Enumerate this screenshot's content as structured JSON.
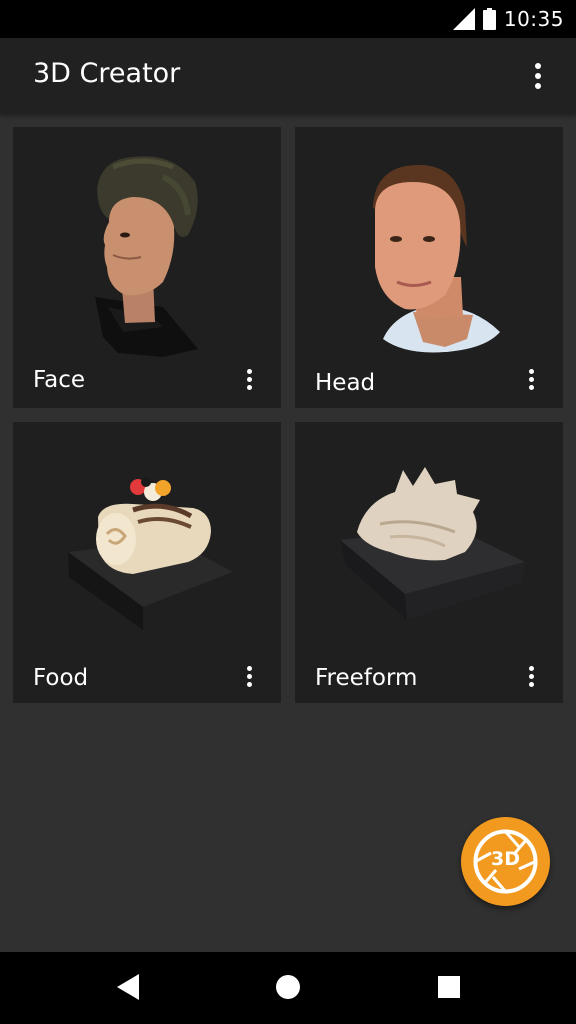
{
  "status_bar": {
    "time": "10:35",
    "icons": [
      "signal-icon",
      "battery-icon"
    ]
  },
  "app_bar": {
    "title": "3D Creator",
    "menu_icon": "more-vert-icon"
  },
  "cards": [
    {
      "label": "Face",
      "menu_icon": "more-vert-icon",
      "image": "face-scan-thumbnail"
    },
    {
      "label": "Head",
      "menu_icon": "more-vert-icon",
      "image": "head-scan-thumbnail"
    },
    {
      "label": "Food",
      "menu_icon": "more-vert-icon",
      "image": "food-scan-thumbnail"
    },
    {
      "label": "Freeform",
      "menu_icon": "more-vert-icon",
      "image": "freeform-scan-thumbnail"
    }
  ],
  "fab": {
    "label": "3D",
    "icon": "camera-shutter-icon",
    "color": "#f29a1f"
  },
  "nav_bar": {
    "icons": [
      "back-icon",
      "home-icon",
      "recents-icon"
    ]
  },
  "colors": {
    "background": "#303030",
    "app_bar": "#212121",
    "card": "#1f1f1f",
    "accent": "#f29a1f"
  }
}
